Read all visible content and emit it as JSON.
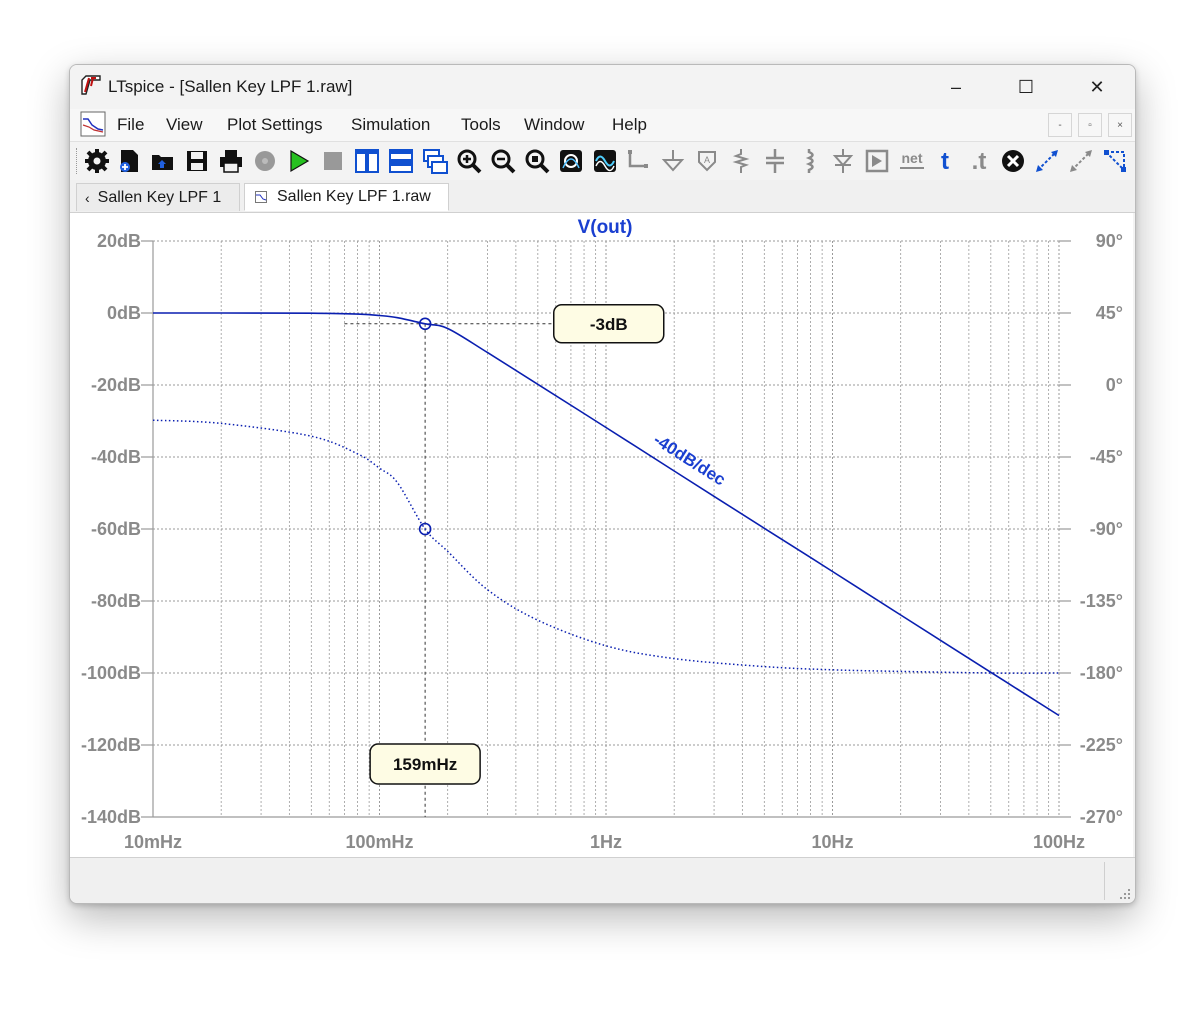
{
  "window": {
    "title": "LTspice - [Sallen Key LPF 1.raw]"
  },
  "title_controls": {
    "minimize": "–",
    "maximize": "☐",
    "close": "✕"
  },
  "menu": {
    "items": [
      "File",
      "View",
      "Plot Settings",
      "Simulation",
      "Tools",
      "Window",
      "Help"
    ]
  },
  "mdi_controls": {
    "minimize": "-",
    "restore": "▫",
    "close": "×"
  },
  "toolbar": {
    "icons": [
      "gear-icon",
      "new-schematic-icon",
      "open-icon",
      "save-icon",
      "print-icon",
      "halt-gear-icon",
      "run-icon",
      "stop-icon",
      "tile-vertical-icon",
      "tile-horizontal-icon",
      "cascade-icon",
      "zoom-in-icon",
      "zoom-out-icon",
      "zoom-fit-icon",
      "autorange-icon",
      "waveform-icon",
      "wire-icon",
      "ground-icon",
      "net-label-icon",
      "resistor-icon",
      "capacitor-icon",
      "inductor-icon",
      "diode-icon",
      "component-icon",
      "net-name-icon",
      "text-icon",
      "spice-directive-icon",
      "delete-icon",
      "move-icon",
      "drag-icon",
      "rotate-icon"
    ],
    "net_label": "net",
    "text_label": "t",
    "directive_label": ".t"
  },
  "tabs": [
    {
      "label": "Sallen Key LPF 1",
      "active": false
    },
    {
      "label": "Sallen Key LPF 1.raw",
      "active": true
    }
  ],
  "colors": {
    "trace": "#0a1fb0",
    "label_trace": "#1a3fd0",
    "axis_text": "#8a8a8a",
    "grid": "#9a9a9a",
    "annotation_bg": "#fefce4"
  },
  "chart_data": {
    "type": "line",
    "title": "V(out)",
    "x_scale": "log",
    "xlim_hz": [
      0.01,
      100
    ],
    "x_ticks": [
      {
        "value": 0.01,
        "label": "10mHz"
      },
      {
        "value": 0.1,
        "label": "100mHz"
      },
      {
        "value": 1,
        "label": "1Hz"
      },
      {
        "value": 10,
        "label": "10Hz"
      },
      {
        "value": 100,
        "label": "100Hz"
      }
    ],
    "ylim_left": [
      -140,
      20
    ],
    "y_ticks_left": [
      "20dB",
      "0dB",
      "-20dB",
      "-40dB",
      "-60dB",
      "-80dB",
      "-100dB",
      "-120dB",
      "-140dB"
    ],
    "ylim_right": [
      -270,
      90
    ],
    "y_ticks_right": [
      "90°",
      "45°",
      "0°",
      "-45°",
      "-90°",
      "-135°",
      "-180°",
      "-225°",
      "-270°"
    ],
    "grid": true,
    "series": [
      {
        "name": "V(out)",
        "kind": "magnitude_db",
        "style": "solid",
        "x": [
          0.01,
          0.02,
          0.05,
          0.08,
          0.1,
          0.12,
          0.159,
          0.2,
          0.3,
          0.5,
          1,
          2,
          5,
          10,
          20,
          50,
          100
        ],
        "y": [
          0,
          -0.01,
          -0.06,
          -0.3,
          -0.7,
          -1.3,
          -3,
          -4.3,
          -11,
          -19.8,
          -31.8,
          -43.9,
          -59.8,
          -71.8,
          -83.9,
          -99.8,
          -111.8
        ]
      },
      {
        "name": "V(out)",
        "kind": "phase_deg",
        "style": "dotted",
        "x": [
          0.01,
          0.02,
          0.05,
          0.08,
          0.1,
          0.12,
          0.159,
          0.2,
          0.3,
          0.5,
          1,
          2,
          5,
          10,
          20,
          50,
          100
        ],
        "y": [
          -22,
          -24,
          -32,
          -43,
          -52,
          -61,
          -90,
          -104,
          -128,
          -147,
          -163,
          -171,
          -176,
          -178,
          -179,
          -180,
          -180
        ]
      }
    ],
    "annotations": [
      {
        "label": "-3dB",
        "x": 0.159,
        "y": -3
      },
      {
        "label": "159mHz",
        "x": 0.159,
        "y": -60
      },
      {
        "label": "-40dB/dec"
      }
    ]
  }
}
